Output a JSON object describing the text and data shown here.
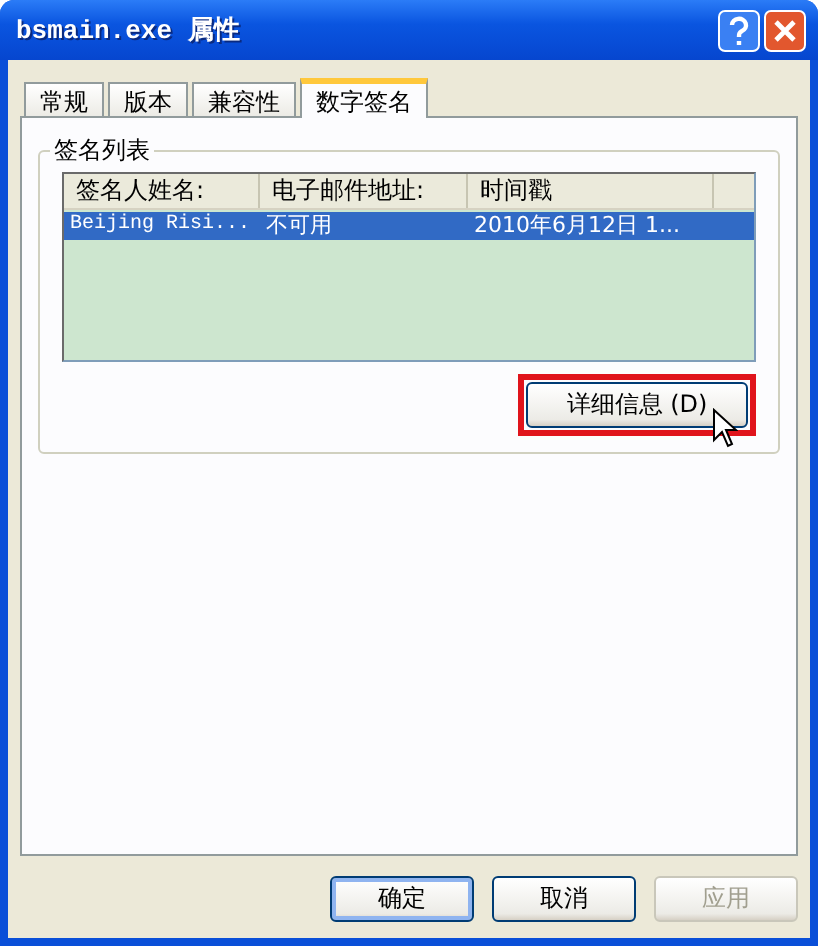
{
  "window": {
    "title": "bsmain.exe 属性"
  },
  "tabs": [
    {
      "label": "常规",
      "selected": false
    },
    {
      "label": "版本",
      "selected": false
    },
    {
      "label": "兼容性",
      "selected": false
    },
    {
      "label": "数字签名",
      "selected": true
    }
  ],
  "signature_group": {
    "title": "签名列表",
    "columns": [
      "签名人姓名:",
      "电子邮件地址:",
      "时间戳"
    ],
    "rows": [
      {
        "cells": [
          "Beijing Risi...",
          "不可用",
          "2010年6月12日 1..."
        ],
        "selected": true
      }
    ],
    "details_button": {
      "label": "详细信息 (D)",
      "highlighted": true
    }
  },
  "buttons": [
    {
      "label": "确定",
      "disabled": false,
      "default": true
    },
    {
      "label": "取消",
      "disabled": false,
      "default": false
    },
    {
      "label": "应用",
      "disabled": true,
      "default": false
    }
  ]
}
